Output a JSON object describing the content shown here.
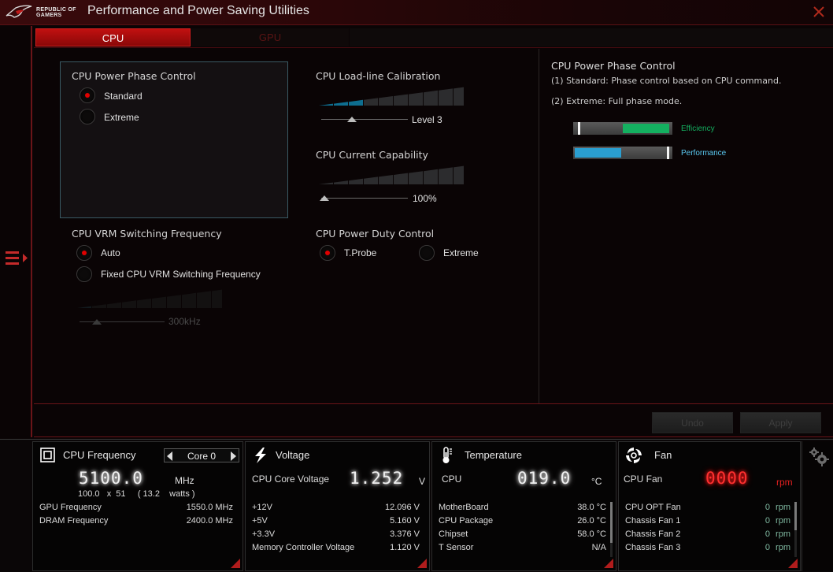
{
  "app": {
    "brand_line1": "REPUBLIC OF",
    "brand_line2": "GAMERS",
    "title": "Performance and Power Saving Utilities",
    "close_icon": "close-x-icon",
    "menu_icon": "sidebar-menu-icon"
  },
  "tabs": [
    {
      "label": "CPU",
      "active": true
    },
    {
      "label": "GPU",
      "active": false
    }
  ],
  "main": {
    "phase_control": {
      "title": "CPU Power Phase Control",
      "options": [
        {
          "label": "Standard",
          "checked": true
        },
        {
          "label": "Extreme",
          "checked": false
        }
      ]
    },
    "loadline": {
      "title": "CPU Load-line Calibration",
      "value_label": "Level 3",
      "level": 3,
      "max_level": 10
    },
    "current_capability": {
      "title": "CPU Current Capability",
      "value_label": "100%",
      "level": 0,
      "max_level": 10
    },
    "vrm_freq": {
      "title": "CPU VRM Switching Frequency",
      "options": [
        {
          "label": "Auto",
          "checked": true
        },
        {
          "label": "Fixed CPU VRM Switching Frequency",
          "checked": false
        }
      ],
      "value_label": "300kHz",
      "enabled": false
    },
    "duty_control": {
      "title": "CPU Power Duty Control",
      "options": [
        {
          "label": "T.Probe",
          "checked": true
        },
        {
          "label": "Extreme",
          "checked": false
        }
      ]
    }
  },
  "info": {
    "title": "CPU Power Phase Control",
    "line1": "(1) Standard: Phase control based on CPU command.",
    "line2": "(2) Extreme: Full phase mode.",
    "efficiency_label": "Efficiency",
    "efficiency_fraction": 0.5,
    "performance_label": "Performance",
    "performance_fraction": 0.5,
    "efficiency_color": "#14b060",
    "performance_color": "#2a9ed0"
  },
  "buttons": {
    "undo": "Undo",
    "apply": "Apply"
  },
  "panels": {
    "cpu_freq": {
      "title": "CPU Frequency",
      "core": "Core 0",
      "value": "5100.0",
      "unit": "MHz",
      "detail": "100.0   x  51     ( 13.2    watts )",
      "rows": [
        {
          "label": "GPU Frequency",
          "value": "1550.0  MHz"
        },
        {
          "label": "DRAM Frequency",
          "value": "2400.0  MHz"
        }
      ]
    },
    "voltage": {
      "title": "Voltage",
      "main_label": "CPU Core Voltage",
      "value": "1.252",
      "unit": "V",
      "rows": [
        {
          "label": "+12V",
          "value": "12.096  V"
        },
        {
          "label": "+5V",
          "value": "5.160  V"
        },
        {
          "label": "+3.3V",
          "value": "3.376  V"
        },
        {
          "label": "Memory Controller Voltage",
          "value": "1.120  V"
        }
      ]
    },
    "temperature": {
      "title": "Temperature",
      "main_label": "CPU",
      "value": "019.0",
      "unit": "°C",
      "rows": [
        {
          "label": "MotherBoard",
          "value": "38.0 °C"
        },
        {
          "label": "CPU Package",
          "value": "26.0 °C"
        },
        {
          "label": "Chipset",
          "value": "58.0 °C"
        },
        {
          "label": "T Sensor",
          "value": "N/A"
        }
      ]
    },
    "fan": {
      "title": "Fan",
      "main_label": "CPU Fan",
      "value": "0000",
      "unit": "rpm",
      "rows": [
        {
          "label": "CPU OPT Fan",
          "value": "0",
          "unit": "rpm"
        },
        {
          "label": "Chassis Fan 1",
          "value": "0",
          "unit": "rpm"
        },
        {
          "label": "Chassis Fan 2",
          "value": "0",
          "unit": "rpm"
        },
        {
          "label": "Chassis Fan 3",
          "value": "0",
          "unit": "rpm"
        }
      ]
    }
  }
}
